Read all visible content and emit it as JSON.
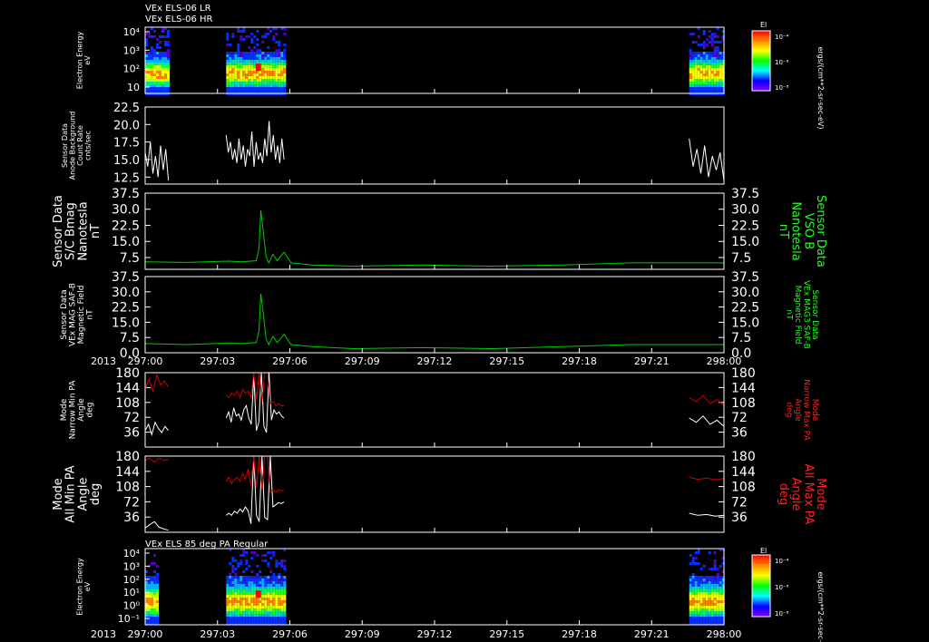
{
  "headers": {
    "top": [
      "VEx ELS-06 LR",
      "VEx ELS-06 HR"
    ],
    "bottom": "VEx ELS 85 deg PA Regular"
  },
  "colorbar": {
    "title": "El",
    "side_label": "ergs/(cm**2-sr-sec-eV)",
    "ticks": [
      "10⁻⁴",
      "10⁻⁶",
      "10⁻⁸"
    ],
    "colors": [
      "#ff0000",
      "#ff8800",
      "#ffff00",
      "#00ff00",
      "#00ffff",
      "#0000ff",
      "#8800ff"
    ]
  },
  "panels": [
    {
      "name": "spectrogram-top",
      "type": "heatmap",
      "ylabel_left": [
        "Electron Energy",
        "eV"
      ],
      "yticks": [
        "10⁴",
        "10³",
        "10²",
        "10"
      ],
      "data_windows": [
        [
          297.0,
          297.0167
        ],
        [
          297.0583,
          297.1
        ],
        [
          297.3917,
          297.4167
        ]
      ]
    },
    {
      "name": "background",
      "type": "line",
      "ylabel_left": [
        "Sensor Data",
        "Anode Background",
        "Count Rate",
        "cnts/sec"
      ],
      "ylim": [
        11.5,
        22.5
      ],
      "yticks": [
        "22.5",
        "20.0",
        "17.5",
        "15.0",
        "12.5"
      ],
      "color": "#ffffff",
      "series": [
        {
          "x": [
            297.0,
            297.0167
          ],
          "values": [
            16,
            14,
            17.5,
            13,
            15.5,
            12.5,
            17,
            13.5,
            16.5,
            12
          ]
        },
        {
          "x": [
            297.0583,
            297.1
          ],
          "values": [
            18.5,
            16,
            17.5,
            15,
            16.5,
            14.5,
            18,
            15,
            17,
            14,
            16.5,
            15.5,
            19,
            14,
            17.5,
            15,
            16,
            14.5,
            18,
            15.5,
            20.5,
            16,
            18.5,
            15,
            17,
            14.5,
            18,
            15
          ]
        },
        {
          "x": [
            297.3917,
            297.4167
          ],
          "values": [
            18,
            14,
            16.5,
            13,
            17,
            12.5,
            15.5,
            13.5,
            16,
            12
          ]
        }
      ]
    },
    {
      "name": "bmag-sc",
      "type": "line",
      "ylabel_left": [
        "Sensor Data",
        "S/C Bmag",
        "Nanotesla",
        "nT"
      ],
      "ylabel_right": [
        "Sensor Data",
        "VSO B",
        "Nanotesla",
        "nT"
      ],
      "ylim": [
        2,
        37.5
      ],
      "yticks": [
        "37.5",
        "30.0",
        "22.5",
        "15.0",
        "7.5"
      ],
      "color": "#00cc00",
      "x": [
        297.0,
        297.03,
        297.06,
        297.07,
        297.08,
        297.082,
        297.0833,
        297.085,
        297.087,
        297.089,
        297.092,
        297.095,
        297.1,
        297.105,
        297.12,
        297.15,
        297.2,
        297.25,
        297.3,
        297.35,
        297.4,
        297.4167
      ],
      "values": [
        5.5,
        5.2,
        5.8,
        5.5,
        6.0,
        12,
        29.5,
        20,
        8,
        5,
        9,
        6,
        10,
        5,
        4,
        3.5,
        4,
        3.5,
        4,
        5,
        5,
        5
      ]
    },
    {
      "name": "bmag-saf",
      "type": "line",
      "ylabel_left": [
        "Sensor Data",
        "VEx MAG SAF-B",
        "Magnetic Field",
        "nT"
      ],
      "ylabel_right": [
        "Sensor Data",
        "VEx MAG3 SAF-B",
        "Magnetic Field",
        "nT"
      ],
      "ylim": [
        0,
        37.5
      ],
      "yticks": [
        "37.5",
        "30.0",
        "22.5",
        "15.0",
        "7.5",
        "0.0"
      ],
      "color": "#00cc00",
      "x": [
        297.0,
        297.03,
        297.06,
        297.07,
        297.08,
        297.082,
        297.0833,
        297.085,
        297.087,
        297.089,
        297.092,
        297.095,
        297.1,
        297.105,
        297.12,
        297.15,
        297.2,
        297.25,
        297.3,
        297.35,
        297.4,
        297.4167
      ],
      "values": [
        4.5,
        4.0,
        4.8,
        4.5,
        5.0,
        11,
        29,
        20,
        7,
        4,
        8,
        5,
        9,
        4,
        3,
        2,
        2.5,
        2,
        3,
        4,
        4,
        4
      ]
    },
    {
      "name": "narrow-pa",
      "type": "line",
      "ylabel_left": [
        "Mode",
        "Narrow Min PA",
        "Angle",
        "deg"
      ],
      "ylabel_right": [
        "Mode",
        "Narrow Max PA",
        "Angle",
        "deg"
      ],
      "ylim": [
        0,
        180
      ],
      "yticks": [
        "180",
        "144",
        "108",
        "72",
        "36"
      ],
      "series": [
        {
          "name": "min",
          "color": "#ffffff",
          "windows": [
            [
              297.0,
              297.0167,
              [
                40,
                55,
                30,
                60,
                45,
                35,
                50,
                40
              ]
            ],
            [
              297.0583,
              297.1,
              [
                70,
                85,
                60,
                95,
                75,
                80,
                65,
                90,
                100,
                70,
                55,
                175,
                40,
                60,
                180,
                50,
                35,
                180,
                65,
                90,
                80,
                85,
                75,
                70
              ]
            ],
            [
              297.3917,
              297.4167,
              [
                70,
                60,
                75,
                55,
                65,
                50
              ]
            ]
          ]
        },
        {
          "name": "max",
          "color": "#cc0000",
          "windows": [
            [
              297.0,
              297.0167,
              [
                140,
                165,
                135,
                175,
                150,
                160,
                145
              ]
            ],
            [
              297.0583,
              297.1,
              [
                125,
                120,
                130,
                125,
                135,
                120,
                140,
                130,
                135,
                120,
                180,
                115,
                180,
                110,
                180,
                180,
                105,
                110,
                100,
                105,
                100,
                100
              ]
            ],
            [
              297.3917,
              297.4167,
              [
                120,
                110,
                125,
                105,
                115,
                100
              ]
            ]
          ]
        }
      ]
    },
    {
      "name": "all-pa",
      "type": "line",
      "ylabel_left": [
        "Mode",
        "All Min PA",
        "Angle",
        "deg"
      ],
      "ylabel_right": [
        "Mode",
        "All Max PA",
        "Angle",
        "deg"
      ],
      "ylim": [
        0,
        180
      ],
      "yticks": [
        "180",
        "144",
        "108",
        "72",
        "36"
      ],
      "series": [
        {
          "name": "min",
          "color": "#ffffff",
          "windows": [
            [
              297.0,
              297.0167,
              [
                10,
                18,
                25,
                12,
                8,
                5
              ]
            ],
            [
              297.0583,
              297.1,
              [
                40,
                45,
                40,
                50,
                45,
                55,
                48,
                60,
                50,
                20,
                180,
                40,
                25,
                180,
                35,
                30,
                180,
                60,
                65,
                70,
                68,
                72
              ]
            ],
            [
              297.3917,
              297.4167,
              [
                45,
                40,
                42,
                38,
                40
              ]
            ]
          ]
        },
        {
          "name": "max",
          "color": "#cc0000",
          "windows": [
            [
              297.0,
              297.0167,
              [
                170,
                175,
                165,
                175,
                170,
                172
              ]
            ],
            [
              297.0583,
              297.1,
              [
                120,
                130,
                115,
                125,
                130,
                120,
                140,
                125,
                150,
                110,
                180,
                105,
                180,
                100,
                180,
                180,
                95,
                100,
                95,
                100,
                98,
                100
              ]
            ],
            [
              297.3917,
              297.4167,
              [
                130,
                125,
                128,
                124,
                127
              ]
            ]
          ]
        }
      ]
    },
    {
      "name": "spectrogram-bottom",
      "type": "heatmap",
      "ylabel_left": [
        "Electron Energy",
        "eV"
      ],
      "yticks": [
        "10⁴",
        "10³",
        "10²",
        "10¹",
        "10⁰",
        "10⁻¹"
      ],
      "data_windows": [
        [
          297.0,
          297.0083
        ],
        [
          297.0583,
          297.1
        ],
        [
          297.3917,
          297.4167
        ]
      ]
    }
  ],
  "xaxis": {
    "range": [
      297.0,
      297.4167
    ],
    "year": "2013",
    "ticks": [
      "297:00",
      "297:03",
      "297:06",
      "297:09",
      "297:12",
      "297:15",
      "297:18",
      "297:21",
      "298:00"
    ]
  }
}
